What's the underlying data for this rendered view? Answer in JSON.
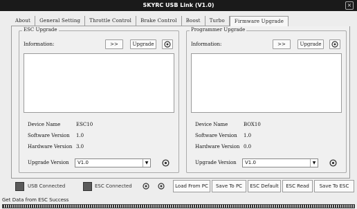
{
  "window": {
    "title": "SKYRC USB Link (V1.0)",
    "close_label": "×"
  },
  "tabs": [
    {
      "label": "About"
    },
    {
      "label": "General Setting"
    },
    {
      "label": "Throttle Control"
    },
    {
      "label": "Brake Control"
    },
    {
      "label": "Boost"
    },
    {
      "label": "Turbo"
    },
    {
      "label": "Firmware Upgrade",
      "active": true
    }
  ],
  "esc_upgrade": {
    "title": "ESC Upgrade",
    "information_label": "Information:",
    "arrow_label": ">>",
    "upgrade_label": "Upgrade",
    "device_name_label": "Device Name",
    "device_name_value": "ESC10",
    "software_version_label": "Software Version",
    "software_version_value": "1.0",
    "hardware_version_label": "Hardware Version",
    "hardware_version_value": "3.0",
    "upgrade_version_label": "Upgrade Version",
    "upgrade_version_value": "V1.0"
  },
  "programmer_upgrade": {
    "title": "Programmer Upgrade",
    "information_label": "Information:",
    "arrow_label": ">>",
    "upgrade_label": "Upgrade",
    "device_name_label": "Device Name",
    "device_name_value": "BOX10",
    "software_version_label": "Software Version",
    "software_version_value": "1.0",
    "hardware_version_label": "Hardware Version",
    "hardware_version_value": "0.0",
    "upgrade_version_label": "Upgrade Version",
    "upgrade_version_value": "V1.0"
  },
  "status": {
    "usb_connected": "USB Connected",
    "esc_connected": "ESC Connected",
    "load_from_pc": "Load From PC",
    "save_to_pc": "Save To PC",
    "esc_default": "ESC Default",
    "esc_read": "ESC Read",
    "save_to_esc": "Save To ESC"
  },
  "message": "Get Data from ESC Success"
}
